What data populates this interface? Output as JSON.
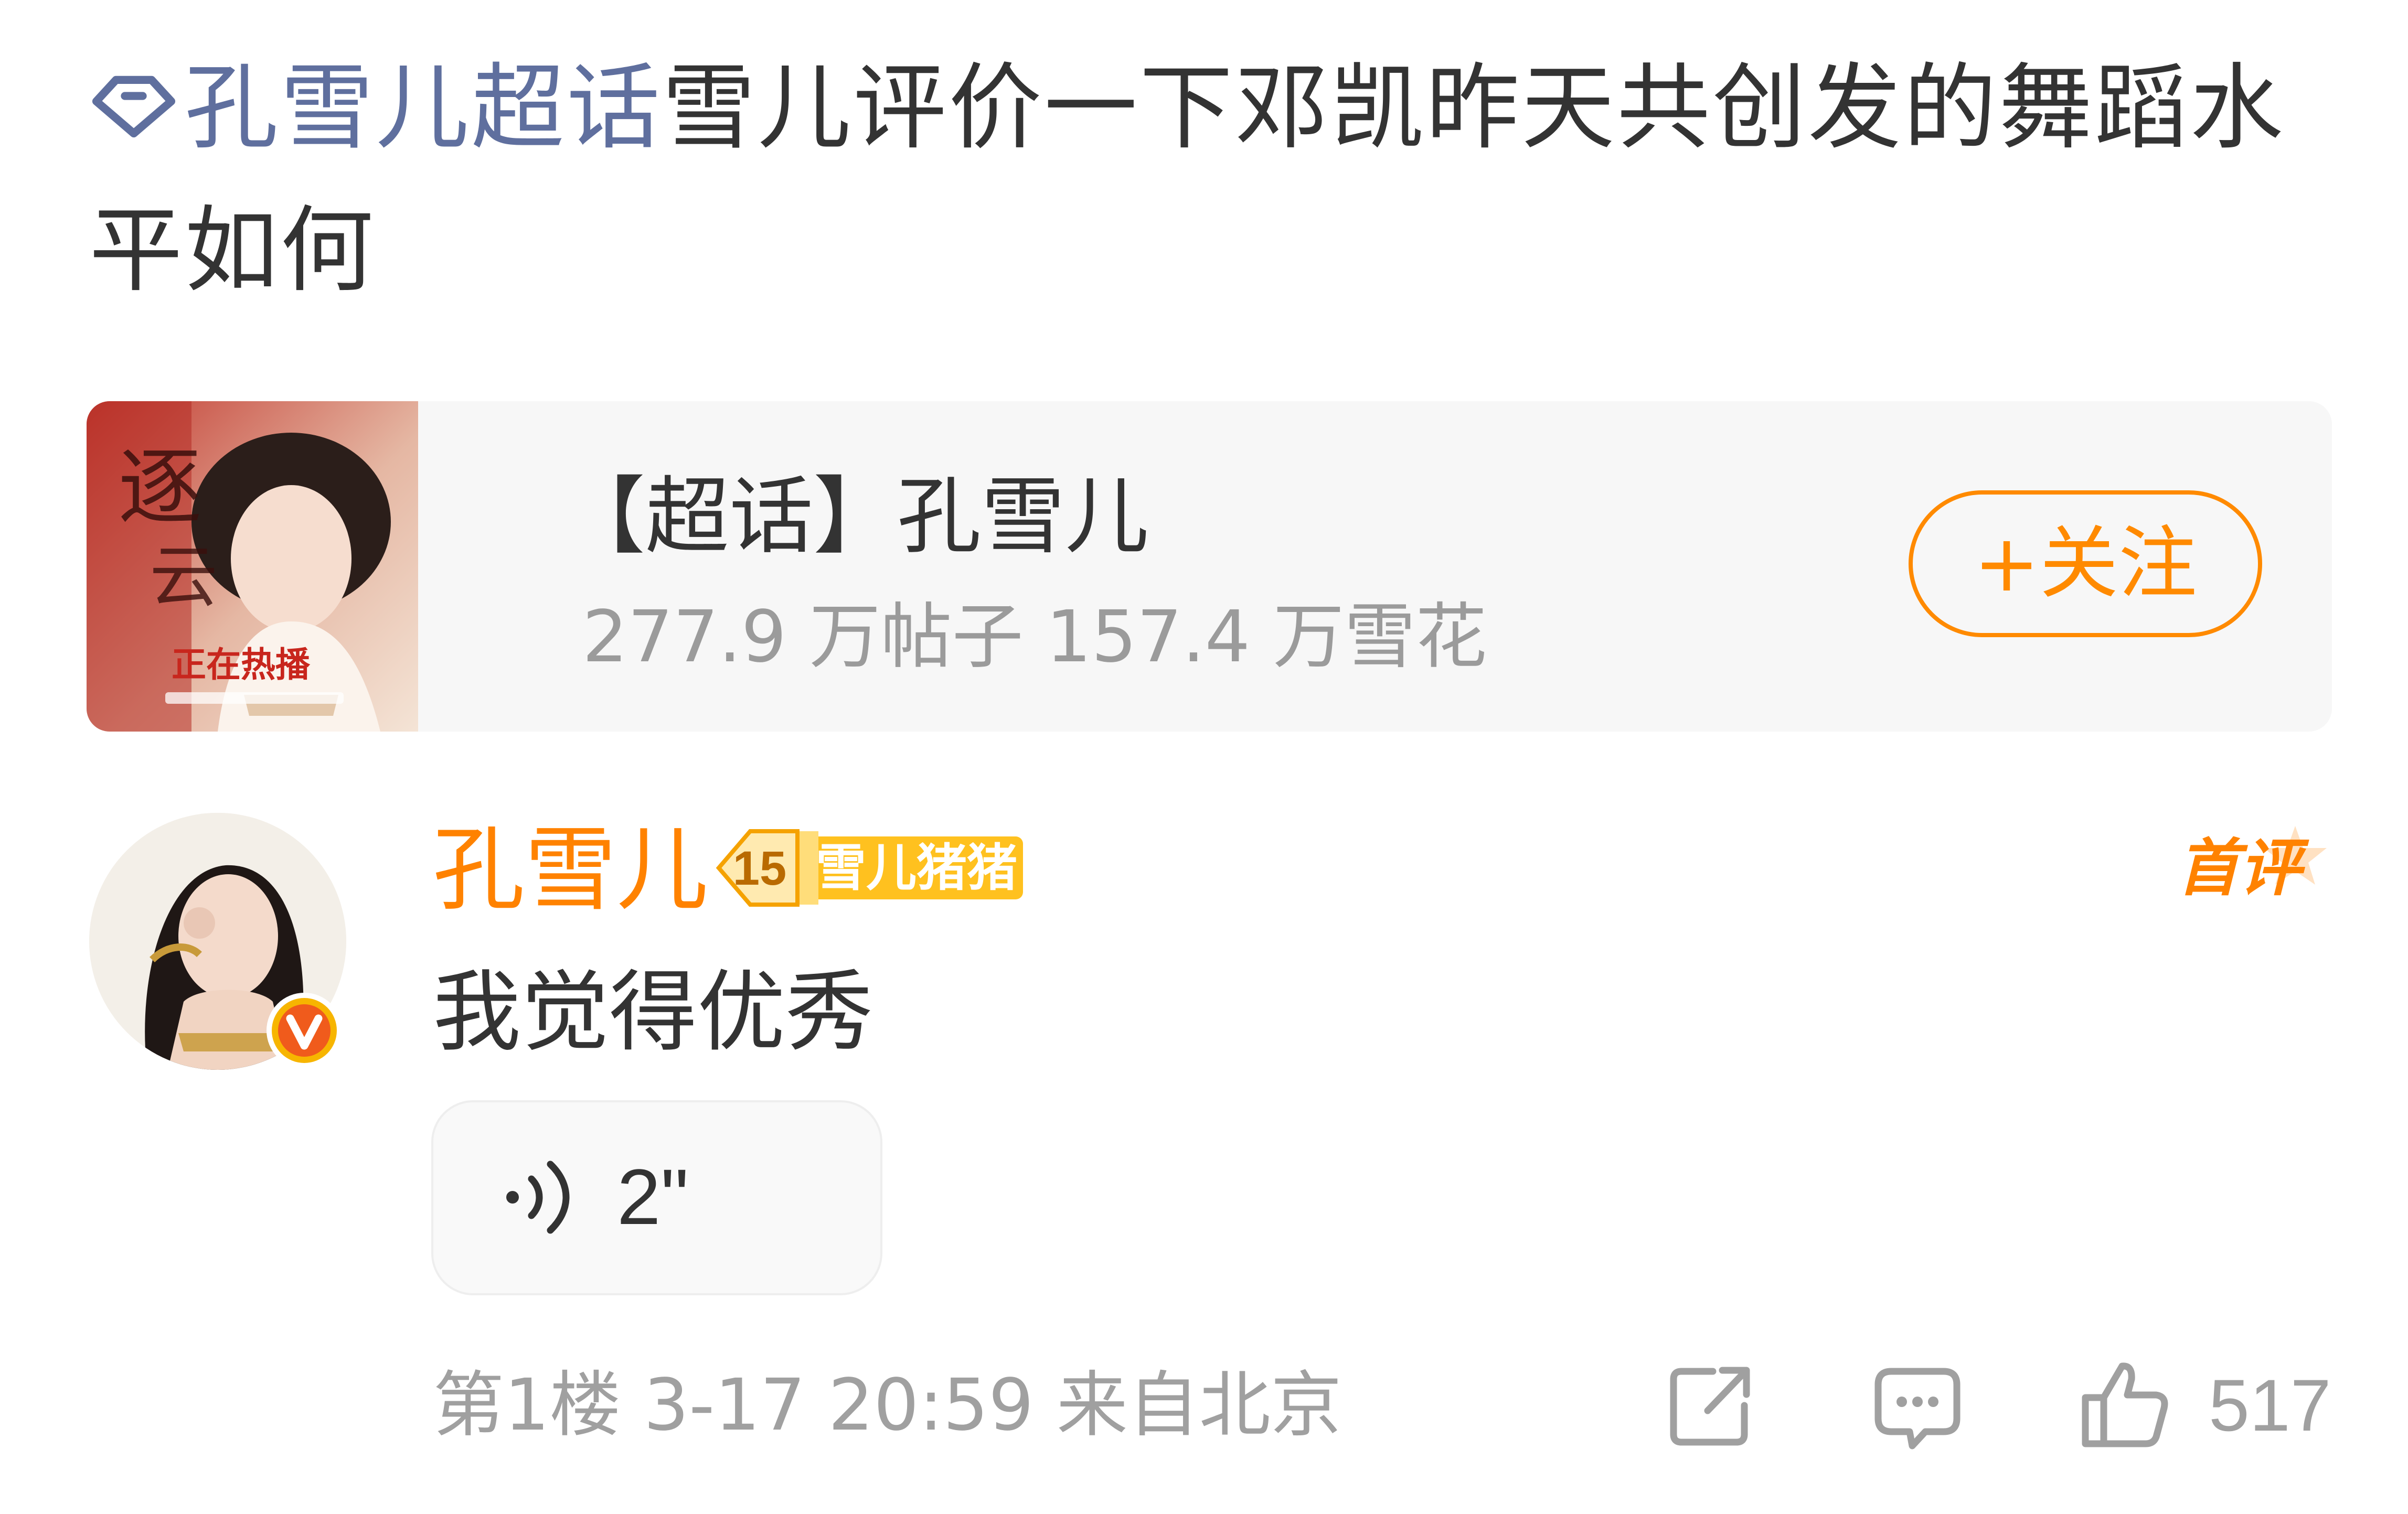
{
  "post": {
    "super_topic_link": "孔雪儿超话",
    "title_text": "雪儿评价一下邓凯昨天共创发的舞蹈水平如何"
  },
  "topic_card": {
    "name": "【超话】孔雪儿",
    "stats": "277.9 万帖子 157.4 万雪花",
    "follow_label": "+关注",
    "thumbnail_caption": "正在热播"
  },
  "comment": {
    "username": "孔雪儿",
    "fan_badge_level": "15",
    "fan_badge_label": "雪儿猪猪",
    "first_comment_tag": "首评",
    "text": "我觉得优秀",
    "voice_duration": "2\"",
    "meta": "第1楼 3-17 20:59 来自北京",
    "like_count": "517"
  },
  "icons": {
    "super_topic": "diamond-icon",
    "verified": "verified-v-icon",
    "voice": "voice-wave-icon",
    "share": "share-icon",
    "reply": "comment-bubble-icon",
    "like": "thumbs-up-icon"
  },
  "colors": {
    "link_blue": "#5f6f9e",
    "accent_orange": "#ff8200",
    "follow_orange": "#ff8a00",
    "meta_gray": "#a0a0a0",
    "text_dark": "#333333",
    "card_bg": "#f7f7f7"
  }
}
